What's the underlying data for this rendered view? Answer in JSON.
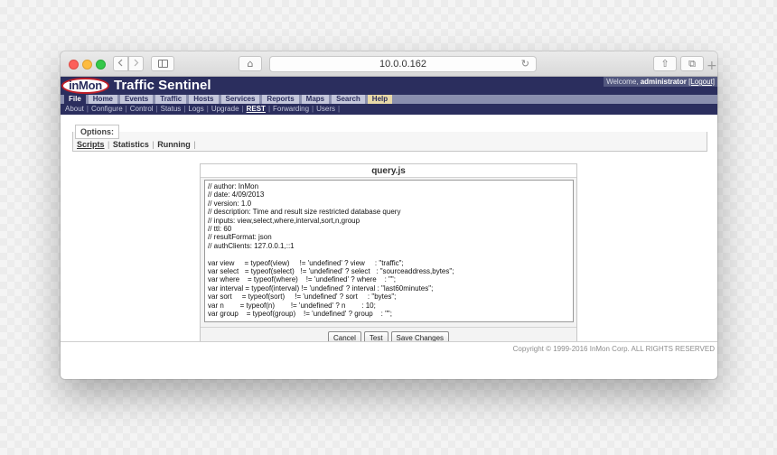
{
  "browser": {
    "url": "10.0.0.162",
    "back_icon": "chevron-left-icon",
    "forward_icon": "chevron-right-icon",
    "home_glyph": "⌂",
    "reload_glyph": "↻",
    "share_glyph": "⇧",
    "tabs_glyph": "⧉",
    "plus_glyph": "+"
  },
  "header": {
    "logo_text": "inMon",
    "app_title": "Traffic Sentinel",
    "welcome_prefix": "Welcome, ",
    "welcome_user": "administrator",
    "logout_label": "[Logout]"
  },
  "main_nav": {
    "tabs": [
      "File",
      "Home",
      "Events",
      "Traffic",
      "Hosts",
      "Services",
      "Reports",
      "Maps",
      "Search",
      "Help"
    ],
    "active": "File"
  },
  "sub_nav": {
    "items": [
      "About",
      "Configure",
      "Control",
      "Status",
      "Logs",
      "Upgrade",
      "REST",
      "Forwarding",
      "Users"
    ],
    "active": "REST"
  },
  "options": {
    "legend": "Options:",
    "tabs": [
      "Scripts",
      "Statistics",
      "Running"
    ],
    "selected": "Scripts"
  },
  "editor": {
    "title": "query.js",
    "code": "// author: InMon\n// date: 4/09/2013\n// version: 1.0\n// description: Time and result size restricted database query\n// inputs: view,select,where,interval,sort,n,group\n// ttl: 60\n// resultFormat: json\n// authClients: 127.0.0.1,::1\n\nvar view     = typeof(view)     != 'undefined' ? view     : \"traffic\";\nvar select   = typeof(select)   != 'undefined' ? select   : \"sourceaddress,bytes\";\nvar where    = typeof(where)    != 'undefined' ? where    : \"\";\nvar interval = typeof(interval) != 'undefined' ? interval : \"last60minutes\";\nvar sort     = typeof(sort)     != 'undefined' ? sort     : \"bytes\";\nvar n        = typeof(n)        != 'undefined' ? n        : 10;\nvar group    = typeof(group)    != 'undefined' ? group    : \"\";",
    "buttons": {
      "cancel": "Cancel",
      "test": "Test",
      "save": "Save Changes"
    }
  },
  "footer": {
    "copyright": "Copyright © 1999-2016 InMon Corp. ALL RIGHTS RESERVED"
  },
  "colors": {
    "header_bg": "#2b2e5e",
    "nav_bg": "#8a8fae",
    "logo_red": "#c01f28",
    "help_tab": "#e8d9a8"
  }
}
